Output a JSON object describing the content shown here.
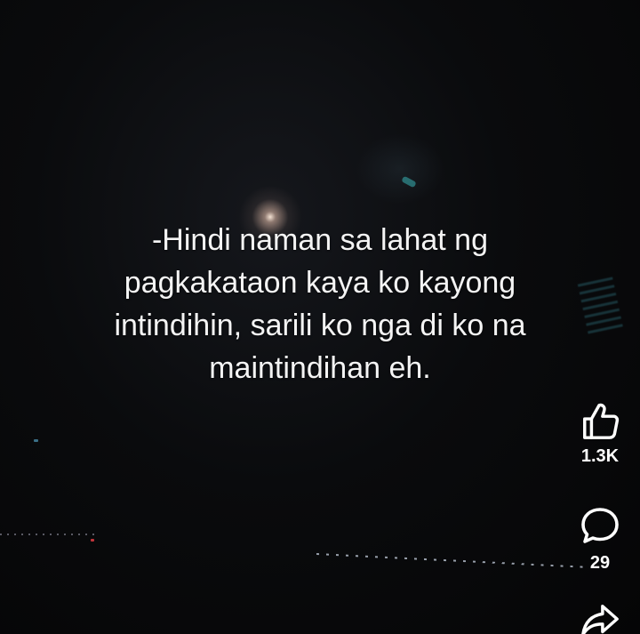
{
  "post": {
    "caption": "-Hindi naman sa lahat ng\npagkakataon kaya ko kayong\nintindihin, sarili ko nga di ko na\nmaintindihan eh."
  },
  "actions": {
    "like": {
      "icon": "thumbs-up-icon",
      "count": "1.3K"
    },
    "comment": {
      "icon": "comment-bubble-icon",
      "count": "29"
    },
    "share": {
      "icon": "share-arrow-icon"
    }
  },
  "colors": {
    "text": "#f4f4f4",
    "icon": "#ffffff",
    "background": "#070708"
  }
}
